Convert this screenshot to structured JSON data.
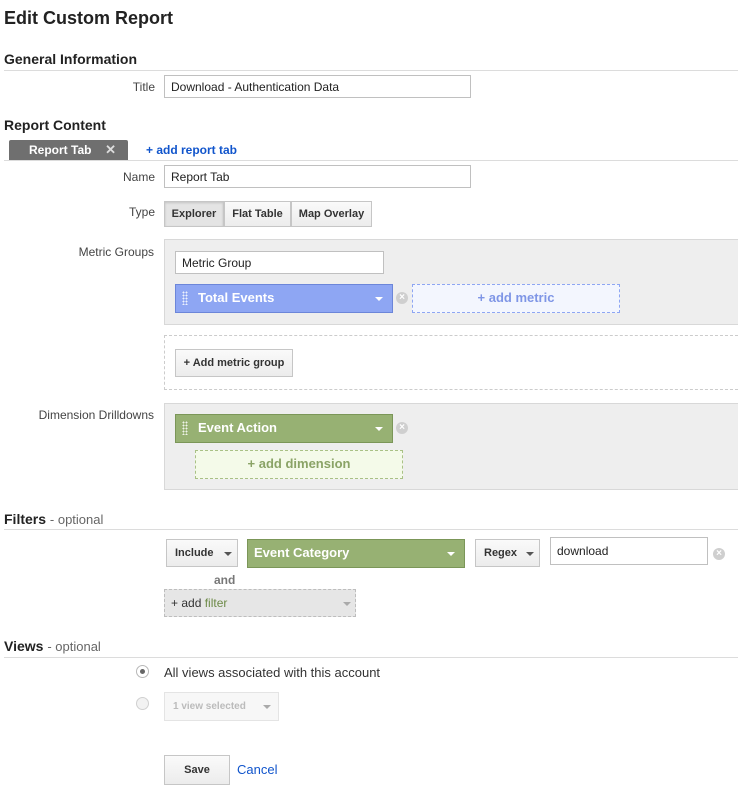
{
  "page": {
    "title": "Edit Custom Report"
  },
  "general": {
    "heading": "General Information",
    "title_label": "Title",
    "title_value": "Download - Authentication Data"
  },
  "content": {
    "heading": "Report Content",
    "active_tab_label": "Report Tab",
    "add_tab_link": "+ add report tab",
    "name_label": "Name",
    "name_value": "Report Tab",
    "type_label": "Type",
    "types": [
      "Explorer",
      "Flat Table",
      "Map Overlay"
    ],
    "selected_type": "Explorer",
    "metric_groups_label": "Metric Groups",
    "metric_group_name": "Metric Group",
    "metric": "Total Events",
    "add_metric": "+ add metric",
    "add_metric_group": "+ Add metric group",
    "dimension_label": "Dimension Drilldowns",
    "dimension": "Event Action",
    "add_dimension": "+ add dimension",
    "metric_color": "#8ea6f3",
    "dimension_color": "#97b173"
  },
  "filters": {
    "heading": "Filters",
    "optional": "- optional",
    "include": "Include",
    "dimension": "Event Category",
    "match_type": "Regex",
    "value": "download",
    "and_label": "and",
    "add_filter_prefix": "+ add ",
    "add_filter_word": "filter"
  },
  "views": {
    "heading": "Views",
    "optional": "- optional",
    "option_all": "All views associated with this account",
    "selected_option": "all",
    "view_select": "1 view selected"
  },
  "actions": {
    "save": "Save",
    "cancel": "Cancel",
    "link_color": "#1155cc"
  }
}
